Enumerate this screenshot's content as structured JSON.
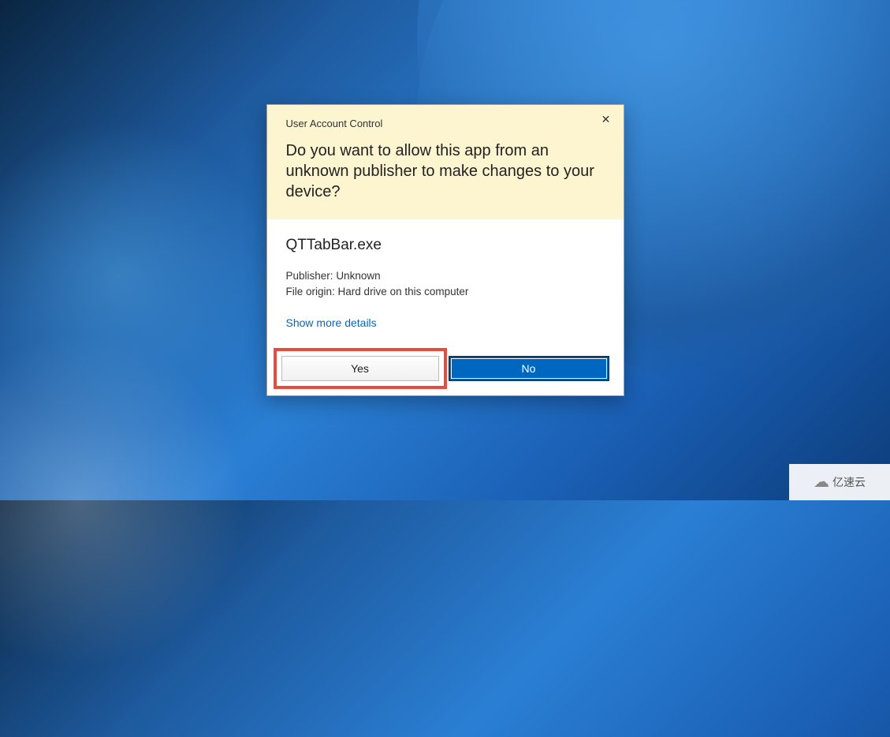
{
  "dialog": {
    "title": "User Account Control",
    "question": "Do you want to allow this app from an unknown publisher to make changes to your device?",
    "app_name": "QTTabBar.exe",
    "publisher_label": "Publisher:",
    "publisher_value": "Unknown",
    "origin_label": "File origin:",
    "origin_value": "Hard drive on this computer",
    "more_details": "Show more details",
    "yes_label": "Yes",
    "no_label": "No"
  },
  "watermark": {
    "text": "亿速云"
  }
}
